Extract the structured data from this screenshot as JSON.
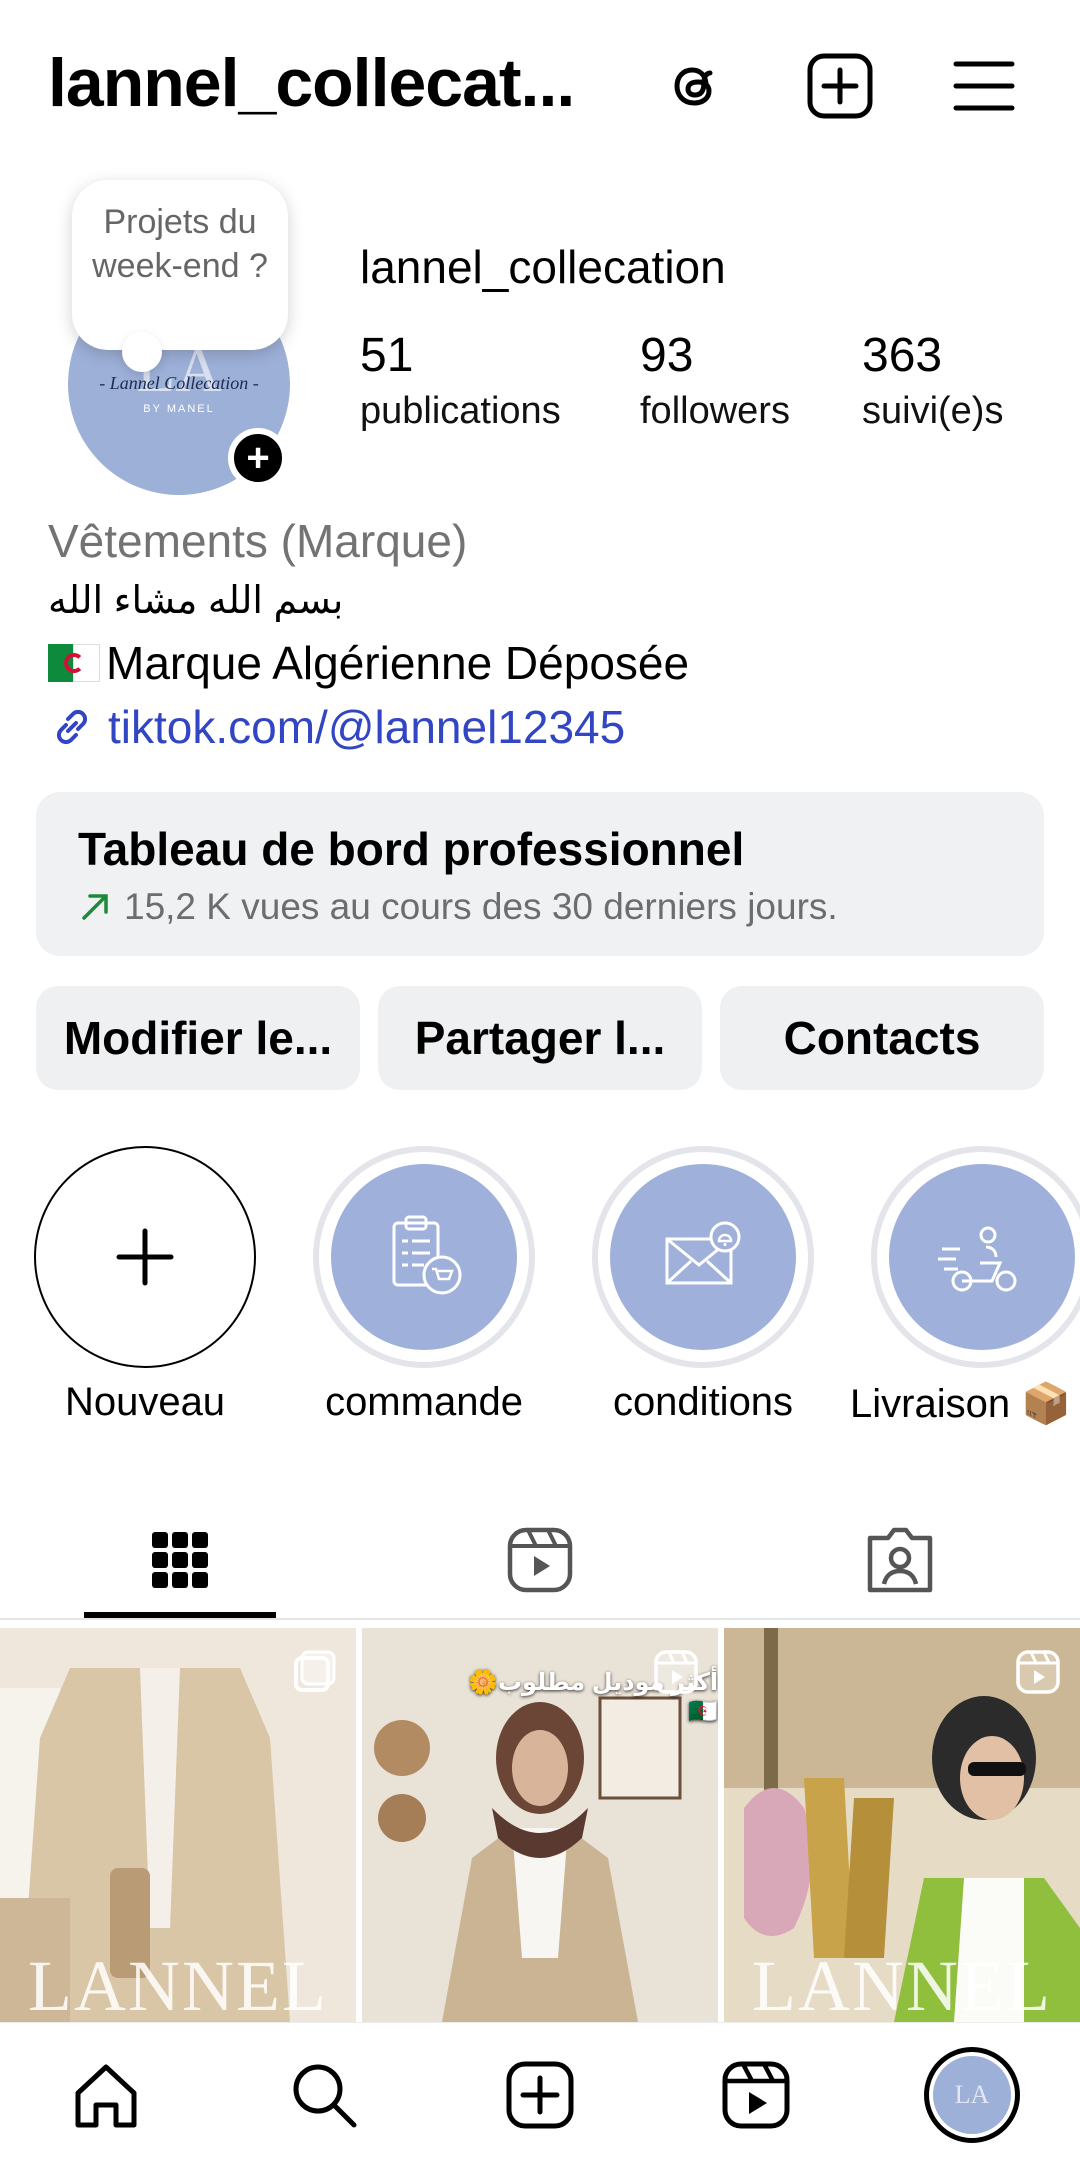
{
  "header": {
    "username": "lannel_collecat...",
    "icons": [
      "threads-icon",
      "create-plus-icon",
      "menu-icon"
    ]
  },
  "note": {
    "text": "Projets du week-end ?"
  },
  "avatar": {
    "text": "LA",
    "subtitle": "- Lannel Collecation -",
    "small": "BY MANEL"
  },
  "profile": {
    "name": "lannel_collecation",
    "stats": [
      {
        "value": "51",
        "label": "publications"
      },
      {
        "value": "93",
        "label": "followers"
      },
      {
        "value": "363",
        "label": "suivi(e)s"
      }
    ]
  },
  "bio": {
    "category": "Vêtements (Marque)",
    "arabic": "بسم الله مشاء الله",
    "line": "Marque Algérienne Déposée",
    "link": "tiktok.com/@lannel12345"
  },
  "dashboard": {
    "title": "Tableau de bord professionnel",
    "subtitle": "15,2 K vues au cours des 30 derniers jours."
  },
  "actions": [
    "Modifier le...",
    "Partager l...",
    "Contacts"
  ],
  "highlights": [
    {
      "label": "Nouveau",
      "icon": "plus-icon"
    },
    {
      "label": "commande",
      "icon": "clipboard-cart-icon"
    },
    {
      "label": "conditions",
      "icon": "envelope-bell-icon"
    },
    {
      "label": "Livraison 📦",
      "icon": "delivery-scooter-icon"
    }
  ],
  "tabs": [
    "grid-icon",
    "reels-icon",
    "tagged-icon"
  ],
  "posts": [
    {
      "caption": "",
      "watermark": "LANNEL",
      "badge": "multi-image-icon",
      "colors": [
        "#efe7dc",
        "#cdb89a",
        "#b69d7b"
      ]
    },
    {
      "caption": "أكثر موديل مطلوب🌼🇩🇿",
      "watermark": "",
      "badge": "reel-icon",
      "colors": [
        "#e8e0d4",
        "#c9b59b",
        "#5a3a30"
      ]
    },
    {
      "caption": "",
      "watermark": "LANNEL",
      "badge": "reel-icon",
      "colors": [
        "#d6c7a7",
        "#c9a349",
        "#8fbf3d"
      ]
    }
  ],
  "bottom_nav": [
    "home-icon",
    "search-icon",
    "create-icon",
    "reels-icon",
    "profile-avatar"
  ],
  "colors": {
    "link": "#3245c2",
    "highlight": "#9fb1da",
    "button_bg": "#eff0f2"
  }
}
